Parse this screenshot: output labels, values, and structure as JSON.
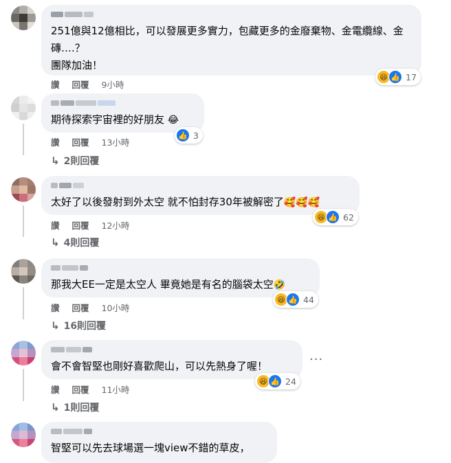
{
  "comments": [
    {
      "text": "251億與12億相比，可以發展更多實力，包藏更多的金廢棄物、金電纜線、金磚….？\n團隊加油！",
      "actions": {
        "like": "讚",
        "reply": "回覆",
        "time": "9小時"
      },
      "reaction_count": "17",
      "replies_label": ""
    },
    {
      "text": "期待探索宇宙裡的好朋友",
      "actions": {
        "like": "讚",
        "reply": "回覆",
        "time": "13小時"
      },
      "reaction_count": "3",
      "replies_label": "2則回覆"
    },
    {
      "text": "太好了以後發射到外太空 就不怕封存30年被解密了",
      "actions": {
        "like": "讚",
        "reply": "回覆",
        "time": "12小時"
      },
      "reaction_count": "62",
      "replies_label": "4則回覆"
    },
    {
      "text": "那我大EE一定是太空人 畢竟她是有名的腦袋太空",
      "actions": {
        "like": "讚",
        "reply": "回覆",
        "time": "10小時"
      },
      "reaction_count": "44",
      "replies_label": "16則回覆"
    },
    {
      "text": "會不會智堅也剛好喜歡爬山，可以先熱身了喔！",
      "actions": {
        "like": "讚",
        "reply": "回覆",
        "time": "11小時"
      },
      "reaction_count": "24",
      "replies_label": "1則回覆"
    },
    {
      "text": "智堅可以先去球場選一塊view不錯的草皮，",
      "actions": {
        "like": "",
        "reply": "",
        "time": ""
      },
      "reaction_count": "",
      "replies_label": ""
    }
  ],
  "colors": {
    "bubble": "#f0f2f5",
    "meta_text": "#65676b",
    "like_blue": "#1877f2",
    "haha_yellow": "#f7b928"
  },
  "icons": {
    "haha": "haha-reaction-icon",
    "like": "like-reaction-icon",
    "reply_arrow": "reply-arrow-icon",
    "more": "more-options-icon"
  }
}
